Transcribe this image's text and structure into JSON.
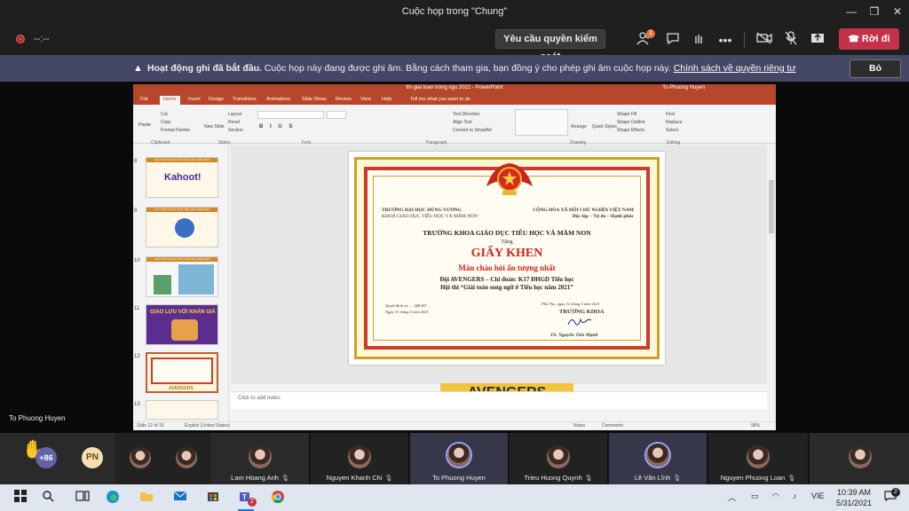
{
  "window": {
    "title": "Cuộc họp trong \"Chung\"",
    "minimize": "—",
    "maximize": "❐",
    "close": "✕"
  },
  "toolbar": {
    "timer": "--:--",
    "request_control": "Yêu cầu quyền kiểm soát",
    "people_badge": "1",
    "leave": "Rời đi"
  },
  "notice": {
    "title": "Hoạt động ghi đã bắt đầu.",
    "message": " Cuộc họp này đang được ghi âm. Bằng cách tham gia, bạn đồng ý cho phép ghi âm cuộc họp này. ",
    "link": "Chính sách về quyền riêng tư",
    "dismiss": "Bỏ"
  },
  "presenter": {
    "name": "To Phuong Huyen"
  },
  "ppt": {
    "doc_title": "thi giai toan trong ngu 2021 - PowerPoint",
    "user": "To Phuong Huyen",
    "tabs": [
      "File",
      "Home",
      "Insert",
      "Design",
      "Transitions",
      "Animations",
      "Slide Show",
      "Review",
      "View",
      "Help",
      "Tell me what you want to do"
    ],
    "ribbon": {
      "paste": "Paste",
      "cut": "Cut",
      "copy": "Copy",
      "format_painter": "Format Painter",
      "clipboard": "Clipboard",
      "new_slide": "New Slide",
      "layout": "Layout",
      "reset": "Reset",
      "section": "Section",
      "slides": "Slides",
      "font": "Font",
      "paragraph": "Paragraph",
      "text_direction": "Text Direction",
      "align_text": "Align Text",
      "convert_smartart": "Convert to SmartArt",
      "drawing": "Drawing",
      "arrange": "Arrange",
      "quick_styles": "Quick Styles",
      "shape_fill": "Shape Fill",
      "shape_outline": "Shape Outline",
      "shape_effects": "Shape Effects",
      "find": "Find",
      "replace": "Replace",
      "select": "Select",
      "editing": "Editing"
    },
    "thumbs": [
      {
        "num": "8",
        "title": "GIẢI TOÁN SONG NGỮ TIỂU HỌC NĂM 2021",
        "text": "Kahoot!"
      },
      {
        "num": "9",
        "title": "GIẢI TOÁN SONG NGỮ TIỂU HỌC NĂM 2021",
        "text": ""
      },
      {
        "num": "10",
        "title": "GIẢI TOÁN SONG NGỮ TIỂU HỌC NĂM 2021",
        "text": ""
      },
      {
        "num": "11",
        "title": "",
        "text": "GIAO LƯU VỚI KHÁN GIẢ"
      },
      {
        "num": "12",
        "title": "",
        "text": "AVENGERS"
      },
      {
        "num": "13",
        "title": "",
        "text": ""
      }
    ],
    "notes_placeholder": "Click to add notes",
    "status": {
      "slide": "Slide 12 of 15",
      "language": "English (United States)",
      "notes": "Notes",
      "comments": "Comments",
      "zoom": "96%"
    },
    "avengers_banner": "AVENGERS"
  },
  "certificate": {
    "school_left_1": "TRƯỜNG ĐẠI HỌC HÙNG VƯƠNG",
    "school_left_2": "KHOA GIÁO DỤC TIỂU HỌC VÀ MẦM NON",
    "nation_1": "CỘNG HÒA XÃ HỘI CHỦ NGHĨA VIỆT NAM",
    "nation_2": "Độc lập – Tự do – Hạnh phúc",
    "heading": "TRƯỞNG KHOA GIÁO DỤC TIỂU HỌC VÀ MẦM NON",
    "tang": "Tặng",
    "award": "GIẤY KHEN",
    "subtitle": "Màn chào hỏi ấn tượng nhất",
    "team": "Đội AVENGERS – Chi đoàn: K17 ĐHGD Tiểu học",
    "contest": "Hội thi “Giải toán song ngữ ở Tiểu học năm 2021”",
    "decision": "Quyết định số:…. QĐ-KT",
    "decision_date": "Ngày 31 tháng 5 năm 2021",
    "place_date": "Phú Thọ, ngày 31 tháng 5 năm 2021",
    "role": "TRƯỞNG KHOA",
    "signer": "TS. Nguyễn Tiến Mạnh"
  },
  "participants": {
    "raised_count": "+86",
    "initials": "PN",
    "tiles": [
      {
        "name": "Lam Hoang Anh"
      },
      {
        "name": "Nguyen Khanh Chi"
      },
      {
        "name": "To Phuong Huyen"
      },
      {
        "name": "Trieu Huong Quynh"
      },
      {
        "name": "Lê Văn Lĩnh"
      },
      {
        "name": "Nguyen Phuong Loan"
      }
    ]
  },
  "taskbar": {
    "lang": "VIE",
    "time": "10:39 AM",
    "date": "5/31/2021",
    "notif_count": "2",
    "teams_badge": "2"
  },
  "colors": {
    "teams_accent": "#6264a7",
    "leave_red": "#c4314b",
    "ppt_red": "#b7472a",
    "notice_bg": "#454766"
  }
}
